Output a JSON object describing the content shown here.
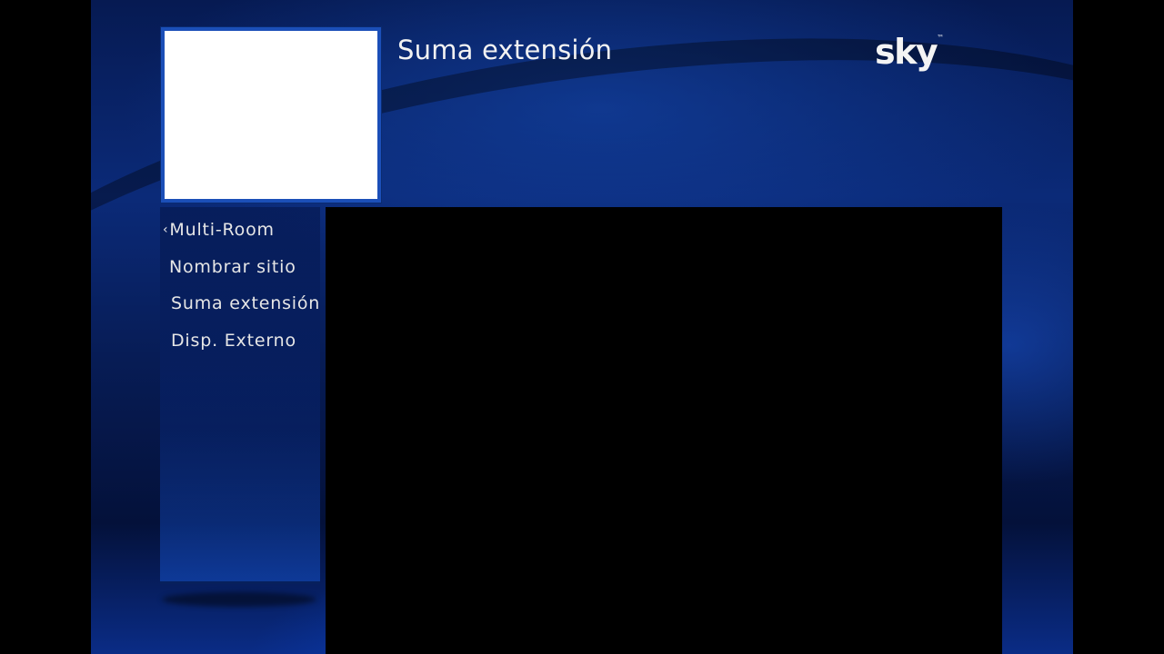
{
  "header": {
    "title": "Suma extensión",
    "logo_text": "sky",
    "logo_mark": "™"
  },
  "menu": {
    "back_arrow": "‹",
    "items": [
      {
        "label": "Multi-Room"
      },
      {
        "label": "Nombrar sitio"
      },
      {
        "label": "Suma extensión"
      },
      {
        "label": "Disp. Externo"
      }
    ]
  },
  "colors": {
    "background": "#0b2a78",
    "thumbnail_border": "#1b4fb8",
    "text": "#e6e6e6",
    "content_panel": "#000000"
  }
}
